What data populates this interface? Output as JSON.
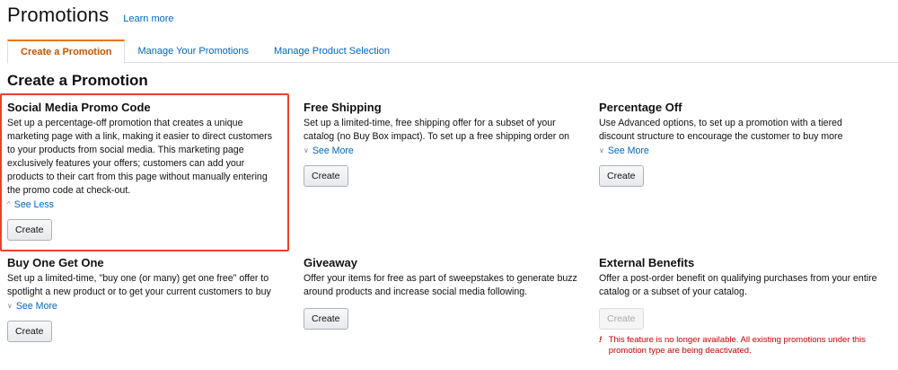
{
  "header": {
    "title": "Promotions",
    "learn_more": "Learn more"
  },
  "tabs": [
    {
      "label": "Create a Promotion",
      "active": true
    },
    {
      "label": "Manage Your Promotions",
      "active": false
    },
    {
      "label": "Manage Product Selection",
      "active": false
    }
  ],
  "section_title": "Create a Promotion",
  "cards": [
    {
      "title": "Social Media Promo Code",
      "description": "Set up a percentage-off promotion that creates a unique marketing page with a link, making it easier to direct customers to your products from social media. This marketing page exclusively features your offers; customers can add your products to their cart from this page without manually entering the promo code at check-out.",
      "toggle": "See Less",
      "button": "Create"
    },
    {
      "title": "Free Shipping",
      "description": "Set up a limited-time, free shipping offer for a subset of your catalog (no Buy Box impact). To set up a free shipping order on",
      "toggle": "See More",
      "button": "Create"
    },
    {
      "title": "Percentage Off",
      "description": "Use Advanced options, to set up a promotion with a tiered discount structure to encourage the customer to buy more",
      "toggle": "See More",
      "button": "Create"
    },
    {
      "title": "Buy One Get One",
      "description": "Set up a limited-time, \"buy one (or many) get one free\" offer to spotlight a new product or to get your current customers to buy",
      "toggle": "See More",
      "button": "Create"
    },
    {
      "title": "Giveaway",
      "description": "Offer your items for free as part of sweepstakes to generate buzz around products and increase social media following.",
      "button": "Create"
    },
    {
      "title": "External Benefits",
      "description": "Offer a post-order benefit on qualifying purchases from your entire catalog or a subset of your catalog.",
      "button": "Create",
      "disabled": true,
      "warning": "This feature is no longer available. All existing promotions under this promotion type are being deactivated."
    }
  ],
  "colors": {
    "link": "#0066c0",
    "active_tab": "#c45500",
    "highlight": "#e8412f",
    "warning": "#c40000"
  }
}
